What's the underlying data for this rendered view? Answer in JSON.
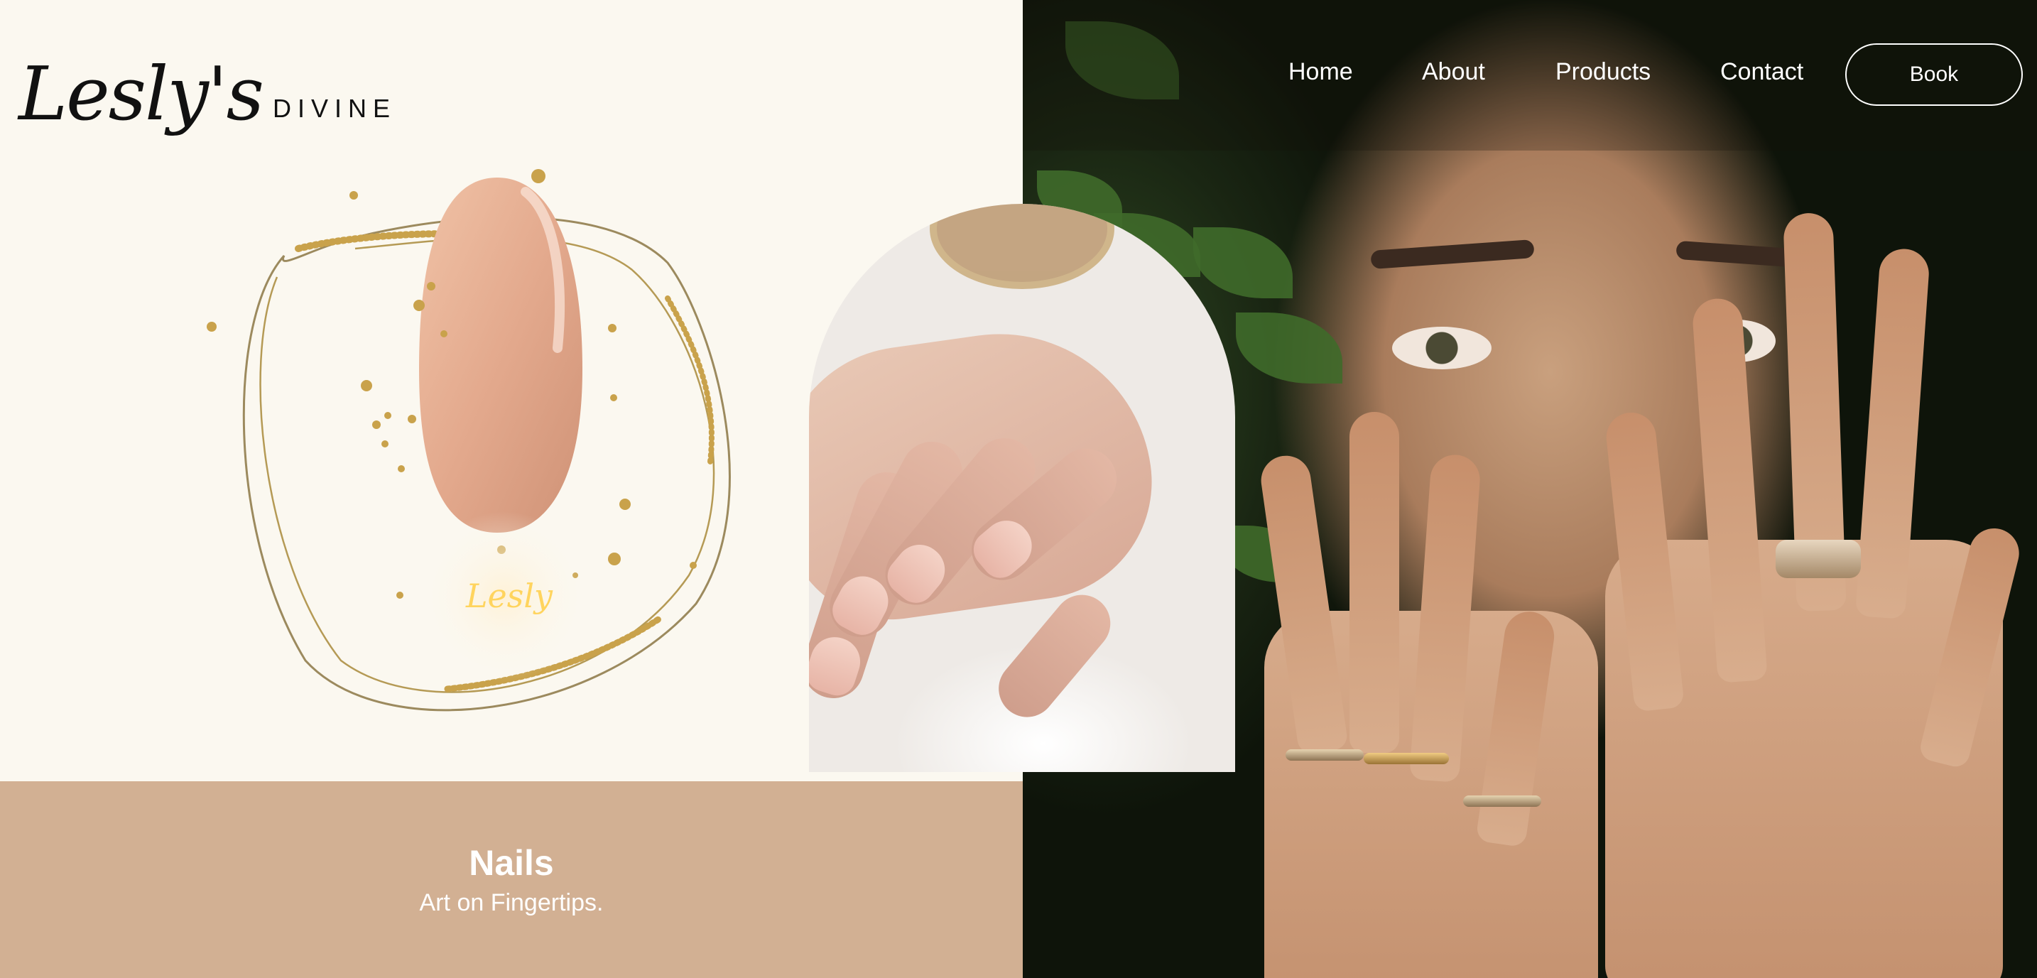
{
  "brand": {
    "script": "Lesly's",
    "word": "DIVINE",
    "nail_signature": "Lesly"
  },
  "nav": {
    "items": [
      {
        "label": "Home"
      },
      {
        "label": "About"
      },
      {
        "label": "Products"
      },
      {
        "label": "Contact"
      }
    ],
    "cta_label": "Book"
  },
  "hero": {
    "title": "Nails",
    "subtitle": "Art on Fingertips."
  },
  "colors": {
    "background": "#fbf8f0",
    "caption_panel": "#d2b093",
    "gold_accent": "#c9a24b",
    "nail_pink": "#e3a98d"
  }
}
